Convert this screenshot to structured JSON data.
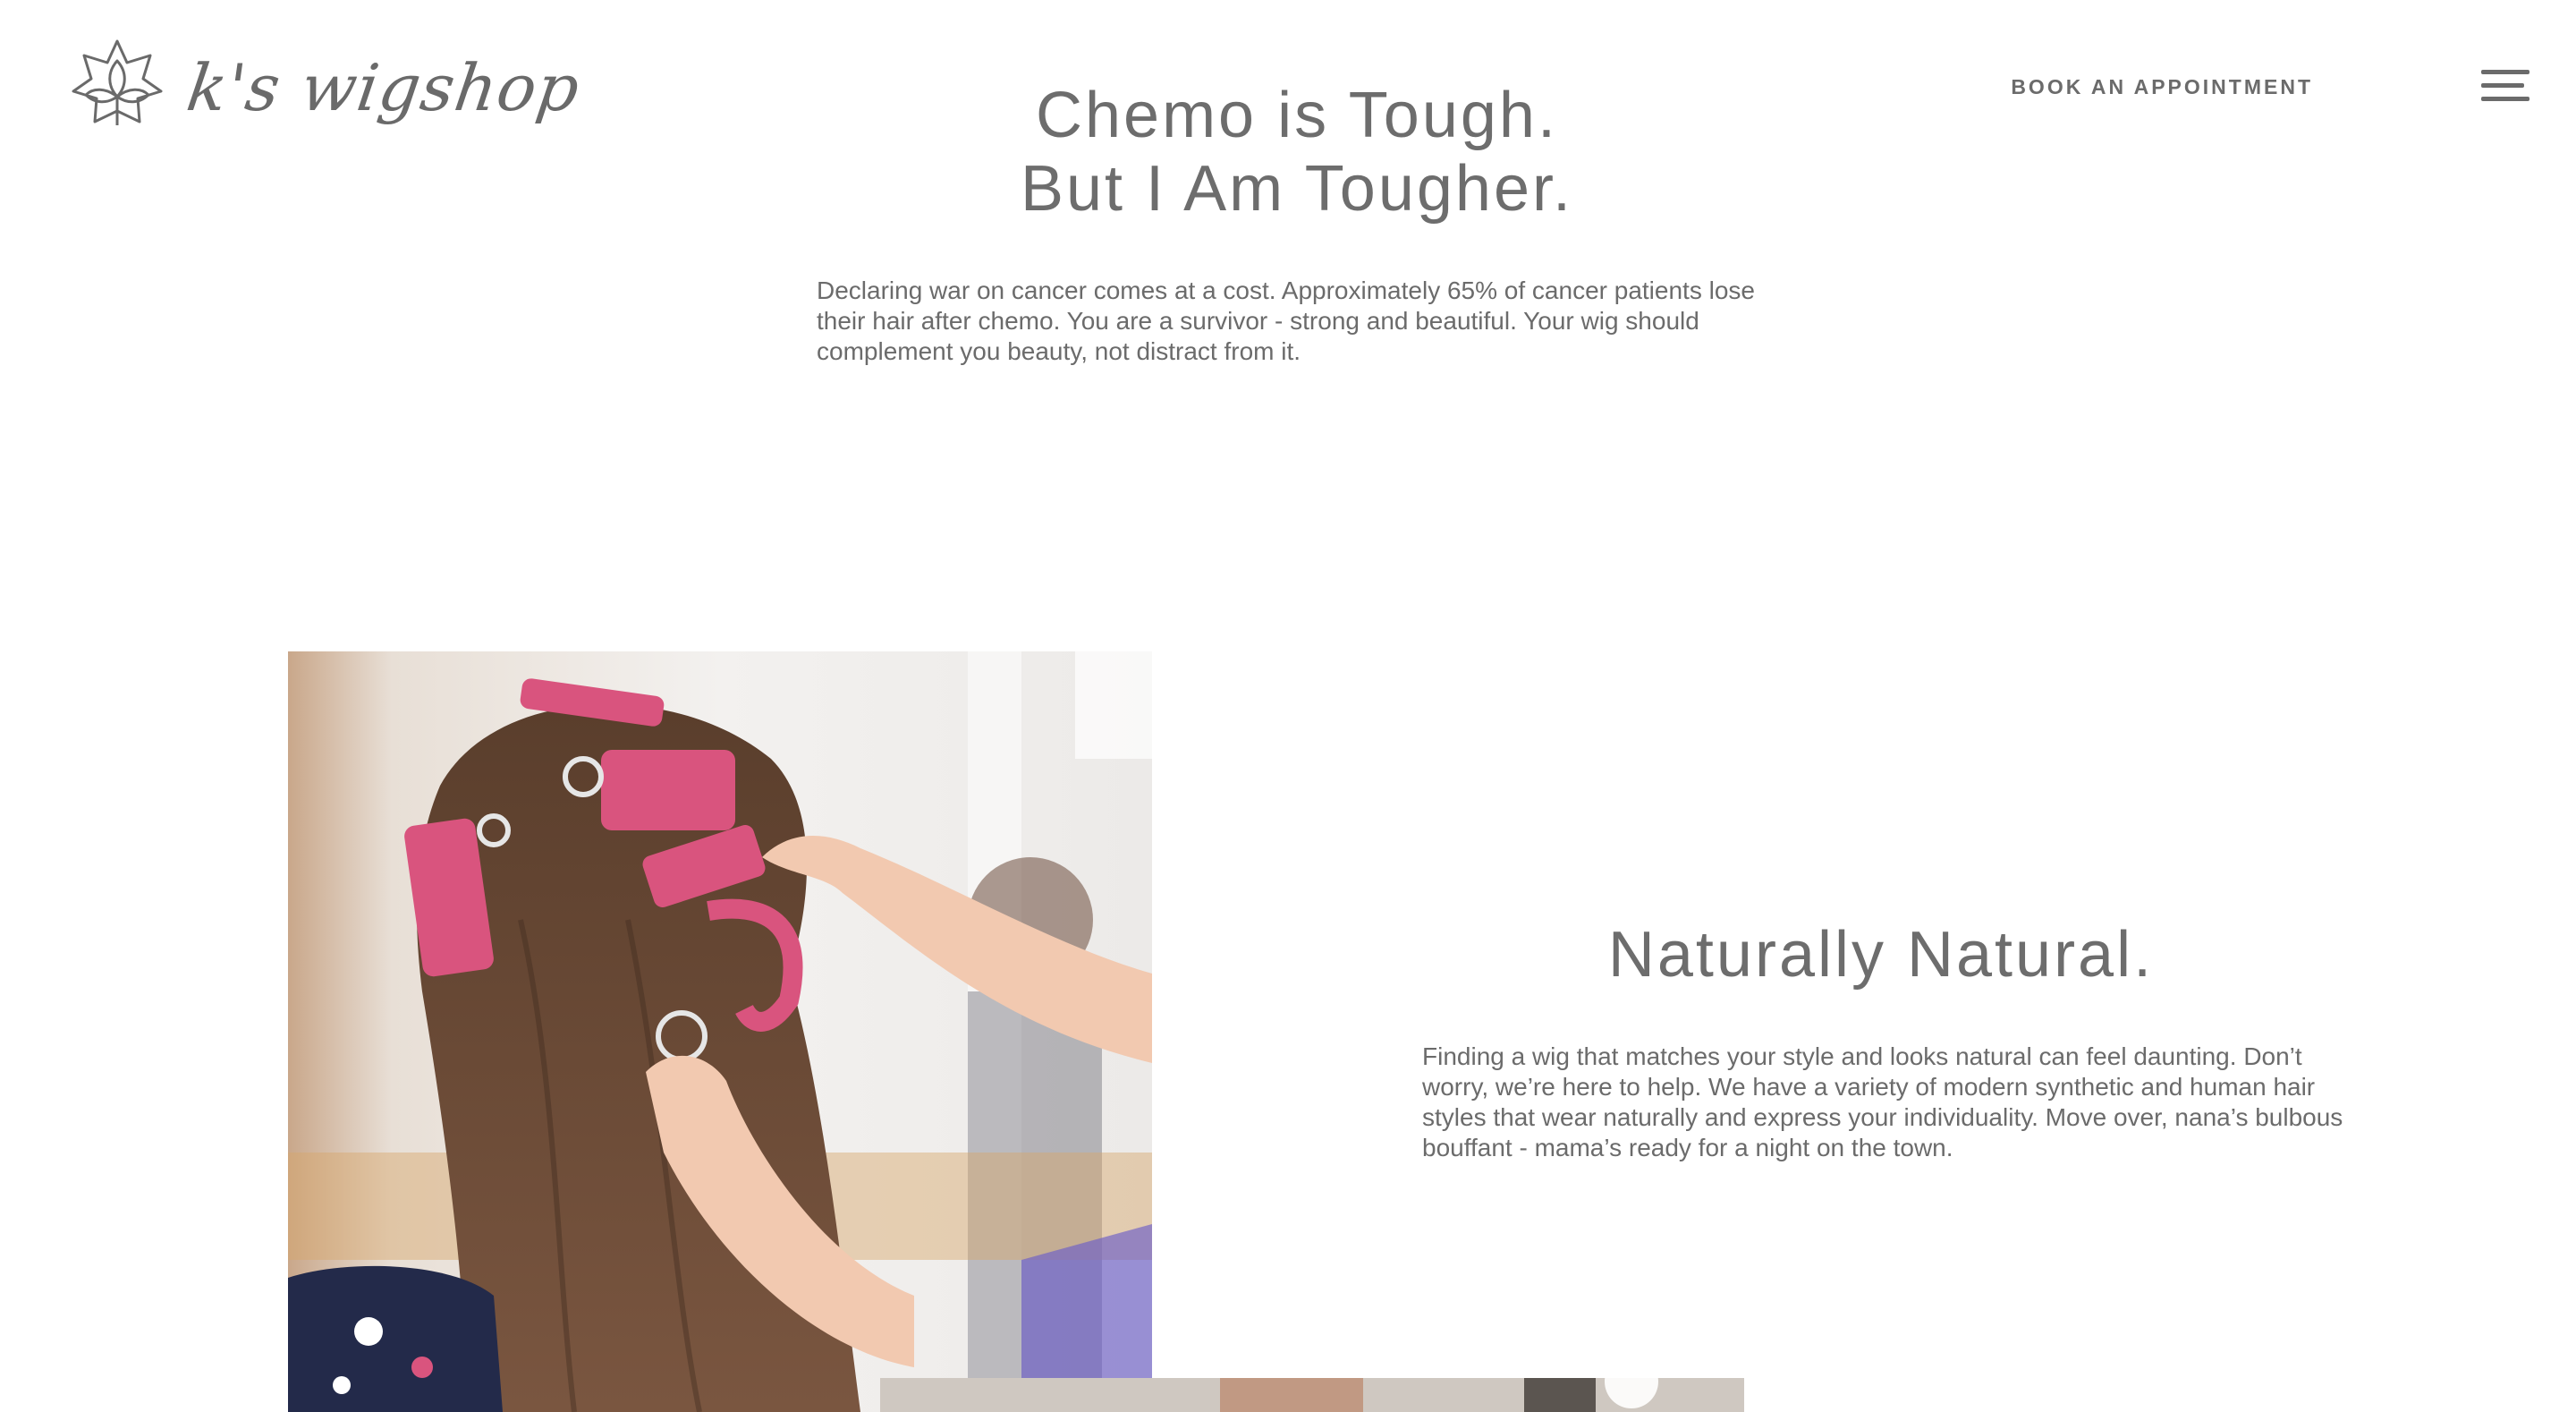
{
  "brand": {
    "logo_text": "k's wigshop",
    "icon": "lotus-flower-icon"
  },
  "nav": {
    "book_label": "BOOK AN APPOINTMENT",
    "menu_icon": "hamburger-menu-icon"
  },
  "hero": {
    "title_line1": "Chemo is Tough.",
    "title_line2": "But I Am Tougher.",
    "body": "Declaring war on cancer comes at a cost. Approximately 65% of cancer patients lose their hair after chemo. You are a survivor - strong and beautiful. Your wig should complement you beauty, not distract from it."
  },
  "natural": {
    "title": "Naturally Natural.",
    "body": "Finding a wig that matches your style and looks natural can feel daunting. Don’t worry, we’re here to help. We have a variety of modern synthetic and human hair styles that wear naturally and express your individuality. Move over, nana’s bulbous bouffant - mama’s ready for a night on the town."
  },
  "colors": {
    "text": "#6b6b6b",
    "background": "#ffffff",
    "accent_pink": "#d9547e"
  }
}
